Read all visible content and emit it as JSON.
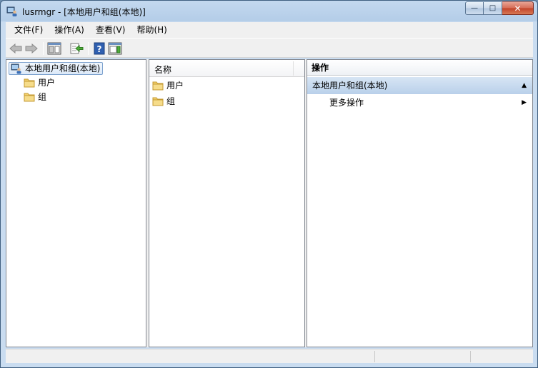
{
  "window": {
    "title": "lusrmgr - [本地用户和组(本地)]",
    "caption": {
      "minimize": "—",
      "maximize": "□",
      "close": "✕"
    }
  },
  "menu": [
    "文件(F)",
    "操作(A)",
    "查看(V)",
    "帮助(H)"
  ],
  "toolbar": {
    "icons": [
      "back-arrow-icon",
      "forward-arrow-icon",
      "show-hide-tree-icon",
      "export-list-icon",
      "help-icon",
      "show-hide-action-pane-icon"
    ]
  },
  "tree": {
    "root": "本地用户和组(本地)",
    "children": [
      "用户",
      "组"
    ]
  },
  "list": {
    "column": "名称",
    "items": [
      "用户",
      "组"
    ]
  },
  "actions": {
    "header": "操作",
    "section": "本地用户和组(本地)",
    "items": [
      "更多操作"
    ]
  },
  "colors": {
    "folder": "#f2cf6b",
    "section_bg": "#c6daf0",
    "selection_border": "#7da2ce"
  }
}
